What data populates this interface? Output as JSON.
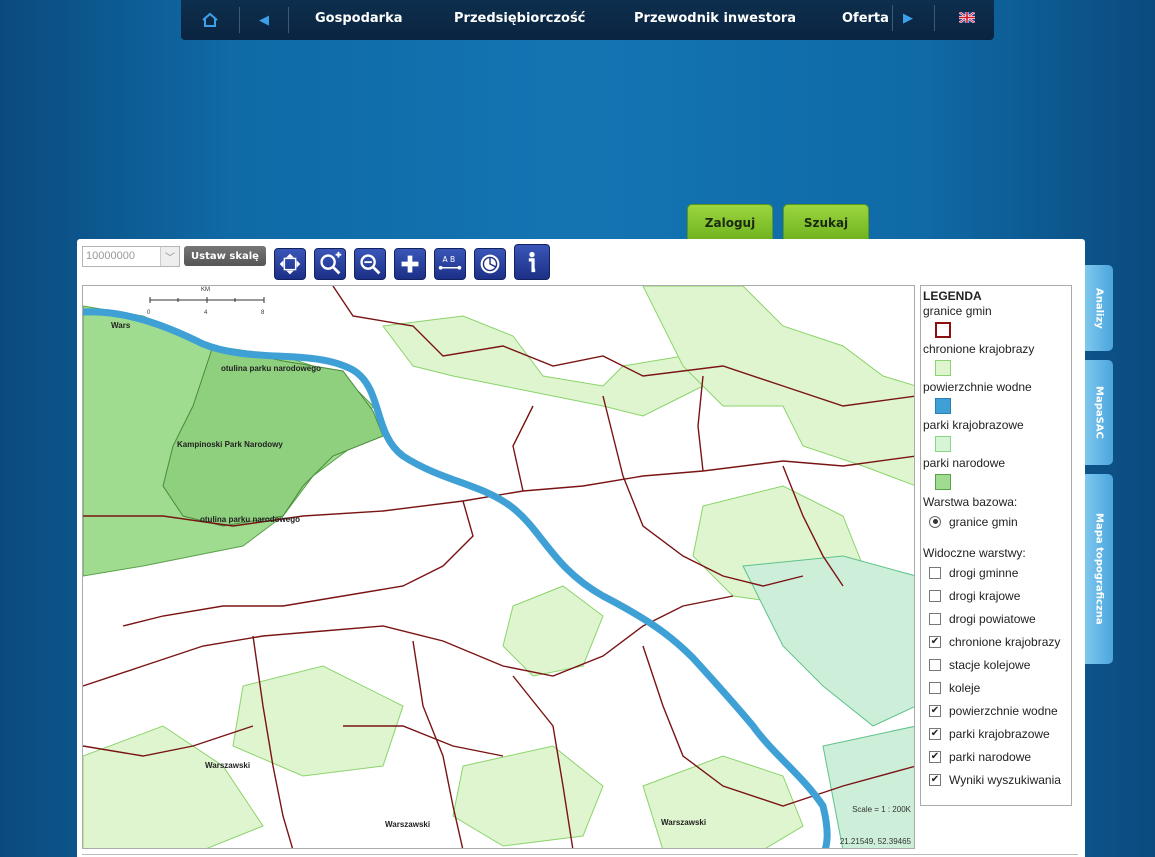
{
  "nav": {
    "items": [
      "Gospodarka",
      "Przedsiębiorczość",
      "Przewodnik inwestora",
      "Oferta"
    ],
    "prev_icon": "left-arrow-icon",
    "next_icon": "right-arrow-icon",
    "home_icon": "home-icon",
    "lang_icon": "uk-flag-icon"
  },
  "tabs": {
    "login": "Zaloguj",
    "search": "Szukaj"
  },
  "toolbar": {
    "scale_value": "10000000",
    "set_scale_label": "Ustaw skalę",
    "tools": [
      "pan-icon",
      "zoom-in-icon",
      "zoom-out-icon",
      "full-extent-icon",
      "measure-icon",
      "identify-layers-icon",
      "info-icon"
    ]
  },
  "map": {
    "labels": {
      "warsaw_top": "Wars",
      "buffer_1": "otulina parku narodowego",
      "kampinos": "Kampinoski Park Narodowy",
      "buffer_2": "otulina parku narodowego",
      "warszawski_1": "Warszawski",
      "warszawski_2": "Warszawski",
      "warszawski_3": "Warszawski"
    },
    "scalebar": {
      "unit": "KM",
      "ticks": [
        "0",
        "4",
        "8"
      ]
    },
    "scale_text": "Scale = 1 : 200K",
    "coords": "21.21549, 52.39465"
  },
  "legend": {
    "title": "LEGENDA",
    "items": [
      {
        "label": "granice gmin",
        "color": "#ffffff",
        "border": "#8b1010"
      },
      {
        "label": "chronione krajobrazy",
        "color": "#dff5cf",
        "border": "#8bd46b"
      },
      {
        "label": "powierzchnie wodne",
        "color": "#3fa0d5",
        "border": "#2a7fb0"
      },
      {
        "label": "parki krajobrazowe",
        "color": "#d6f5d6",
        "border": "#8bd48b"
      },
      {
        "label": "parki narodowe",
        "color": "#9fdc8f",
        "border": "#5aa04a"
      }
    ],
    "base_layer_title": "Warstwa bazowa:",
    "base_layer": "granice gmin",
    "visible_title": "Widoczne warstwy:",
    "layers": [
      {
        "label": "drogi gminne",
        "checked": false
      },
      {
        "label": "drogi krajowe",
        "checked": false
      },
      {
        "label": "drogi powiatowe",
        "checked": false
      },
      {
        "label": "chronione krajobrazy",
        "checked": true
      },
      {
        "label": "stacje kolejowe",
        "checked": false
      },
      {
        "label": "koleje",
        "checked": false
      },
      {
        "label": "powierzchnie wodne",
        "checked": true
      },
      {
        "label": "parki krajobrazowe",
        "checked": true
      },
      {
        "label": "parki narodowe",
        "checked": true
      },
      {
        "label": "Wyniki wyszukiwania",
        "checked": true
      }
    ]
  },
  "side_tabs": [
    "Analizy",
    "MapaSAC",
    "Mapa topograficzna"
  ]
}
